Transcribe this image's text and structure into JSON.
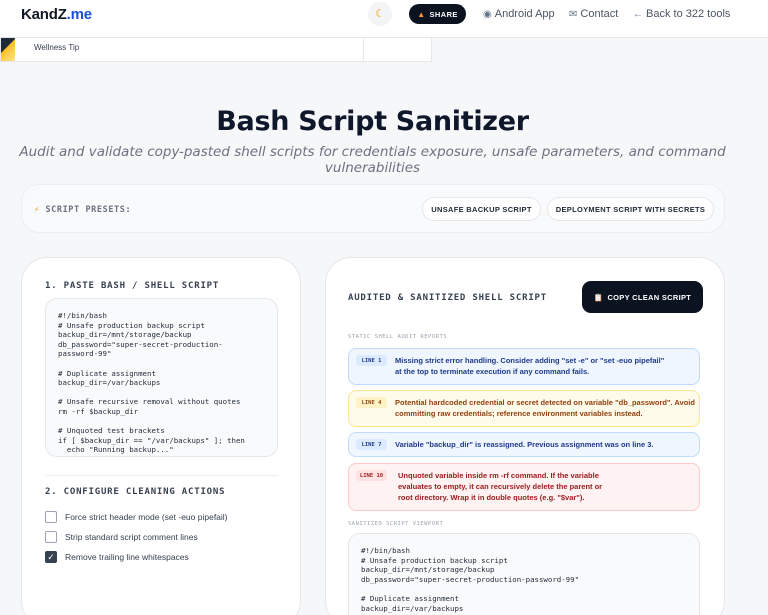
{
  "nav": {
    "logo_main": "KandZ",
    "logo_tld": ".me",
    "theme_icon": "moon-icon",
    "share_label": "SHARE",
    "share_icon": "share-icon",
    "android_label": "Android App",
    "android_icon": "android-icon",
    "contact_label": "Contact",
    "contact_icon": "mail-icon",
    "back_label": "Back to 322 tools",
    "back_icon": "arrow-left-icon"
  },
  "ad": {
    "label": "Wellness Tip"
  },
  "header": {
    "title": "Bash Script Sanitizer",
    "subtitle": "Audit and validate copy-pasted shell scripts for credentials exposure, unsafe parameters, and command vulnerabilities"
  },
  "presets": {
    "label": "SCRIPT PRESETS:",
    "icon": "lightning-icon",
    "buttons": [
      "UNSAFE BACKUP SCRIPT",
      "DEPLOYMENT SCRIPT WITH SECRETS"
    ]
  },
  "input_panel": {
    "heading": "1. PASTE BASH / SHELL SCRIPT",
    "script": "#!/bin/bash\n# Unsafe production backup script\nbackup_dir=/mnt/storage/backup\ndb_password=\"super-secret-production-\npassword-99\"\n\n# Duplicate assignment\nbackup_dir=/var/backups\n\n# Unsafe recursive removal without quotes\nrm -rf $backup_dir\n\n# Unquoted test brackets\nif [ $backup_dir == \"/var/backups\" ]; then\n  echo \"Running backup...\"",
    "options_heading": "2. CONFIGURE CLEANING ACTIONS",
    "options": [
      {
        "label": "Force strict header mode (set -euo pipefail)",
        "checked": false
      },
      {
        "label": "Strip standard script comment lines",
        "checked": false
      },
      {
        "label": "Remove trailing line whitespaces",
        "checked": true
      }
    ]
  },
  "output_panel": {
    "heading": "AUDITED & SANITIZED SHELL SCRIPT",
    "copy_label": "COPY CLEAN SCRIPT",
    "copy_icon": "clipboard-icon",
    "reports_heading": "STATIC SHELL AUDIT REPORTS",
    "findings": [
      {
        "line": "LINE 1",
        "severity": "info",
        "message": "Missing strict error handling. Consider adding \"set -e\" or \"set -euo pipefail\" at the top to terminate execution if any command fails."
      },
      {
        "line": "LINE 4",
        "severity": "warning",
        "message": "Potential hardcoded credential or secret detected on variable \"db_password\". Avoid committing raw credentials; reference environment variables instead."
      },
      {
        "line": "LINE 7",
        "severity": "info",
        "message": "Variable \"backup_dir\" is reassigned. Previous assignment was on line 3."
      },
      {
        "line": "LINE 10",
        "severity": "error",
        "message": "Unquoted variable inside rm -rf command. If the variable evaluates to empty, it can recursively delete the parent or root directory. Wrap it in double quotes (e.g. \"$var\")."
      }
    ],
    "viewport_heading": "SANITIZED SCRIPT VIEWPORT",
    "sanitized_script": "#!/bin/bash\n# Unsafe production backup script\nbackup_dir=/mnt/storage/backup\ndb_password=\"super-secret-production-password-99\"\n\n# Duplicate assignment\nbackup_dir=/var/backups"
  },
  "colors": {
    "dark_button": "#0b1220",
    "info_bg": "#eff6ff",
    "warning_bg": "#fffbeb",
    "error_bg": "#fef2f2"
  }
}
